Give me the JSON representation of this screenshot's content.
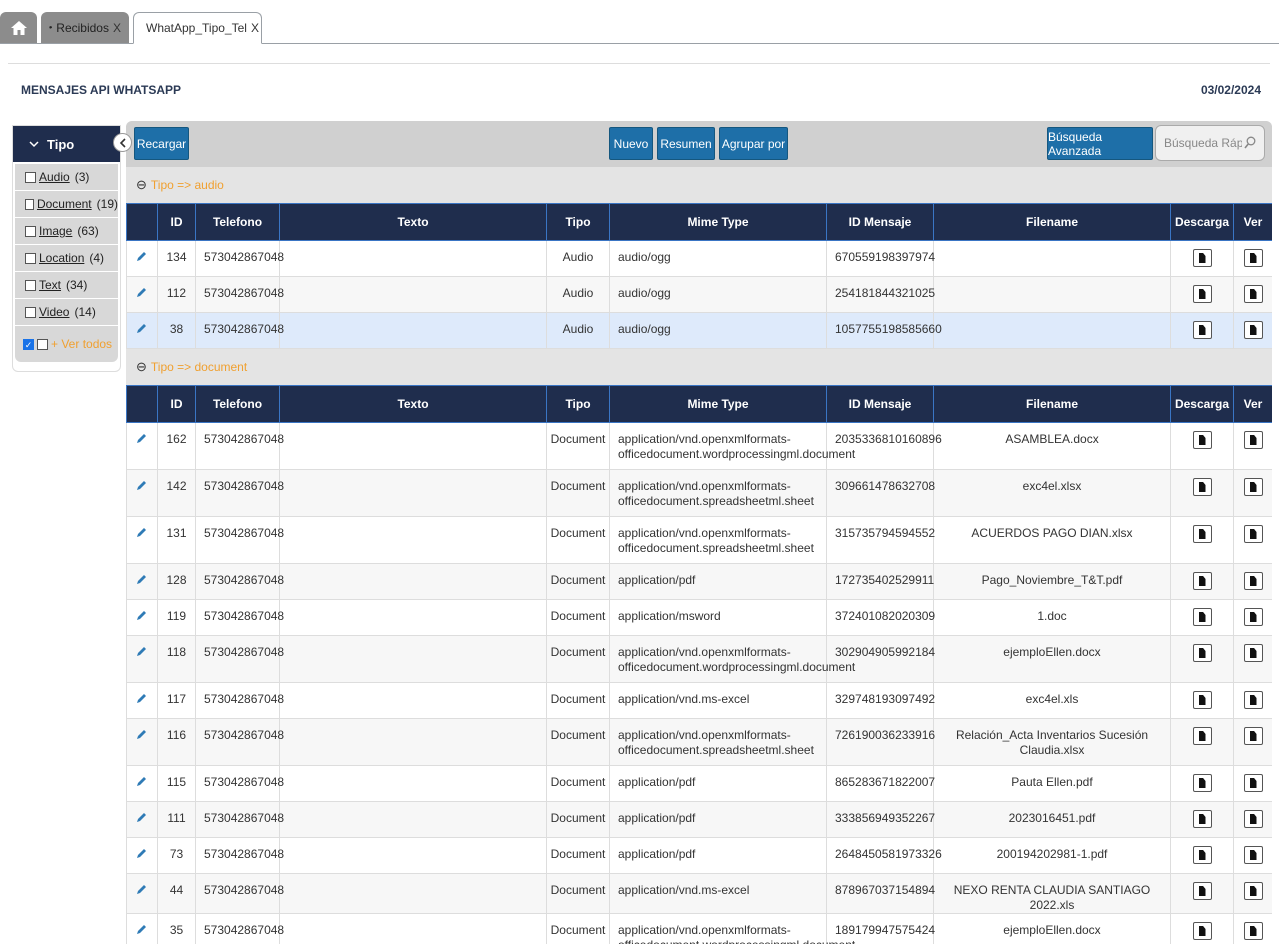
{
  "tabs": [
    {
      "label": "Recibidos",
      "close": "X"
    },
    {
      "label": "WhatApp_Tipo_Tel",
      "close": "X"
    }
  ],
  "page": {
    "title": "MENSAJES API WHATSAPP",
    "date": "03/02/2024"
  },
  "filter": {
    "title": "Tipo",
    "items": [
      {
        "label": "Audio",
        "count": "(3)"
      },
      {
        "label": "Document",
        "count": "(19)"
      },
      {
        "label": "Image",
        "count": "(63)"
      },
      {
        "label": "Location",
        "count": "(4)"
      },
      {
        "label": "Text",
        "count": "(34)"
      },
      {
        "label": "Video",
        "count": "(14)"
      }
    ],
    "all_label": "+ Ver todos"
  },
  "toolbar": {
    "reload": "Recargar",
    "new": "Nuevo",
    "summary": "Resumen",
    "group_by": "Agrupar por",
    "advanced_search": "Búsqueda Avanzada",
    "quick_search_placeholder": "Búsqueda Rápida"
  },
  "columns": [
    "ID",
    "Telefono",
    "Texto",
    "Tipo",
    "Mime Type",
    "ID Mensaje",
    "Filename",
    "Descarga",
    "Ver"
  ],
  "groups": [
    {
      "label": "Tipo => audio",
      "rows": [
        {
          "id": "134",
          "tel": "573042867048",
          "texto": "",
          "tipo": "Audio",
          "mime": "audio/ogg",
          "msg": "670559198397974",
          "file": ""
        },
        {
          "id": "112",
          "tel": "573042867048",
          "texto": "",
          "tipo": "Audio",
          "mime": "audio/ogg",
          "msg": "254181844321025",
          "file": ""
        },
        {
          "id": "38",
          "tel": "573042867048",
          "texto": "",
          "tipo": "Audio",
          "mime": "audio/ogg",
          "msg": "1057755198585660",
          "file": ""
        }
      ]
    },
    {
      "label": "Tipo => document",
      "rows": [
        {
          "id": "162",
          "tel": "573042867048",
          "texto": "",
          "tipo": "Document",
          "mime": "application/vnd.openxmlformats-officedocument.wordprocessingml.document",
          "msg": "2035336810160896",
          "file": "ASAMBLEA.docx"
        },
        {
          "id": "142",
          "tel": "573042867048",
          "texto": "",
          "tipo": "Document",
          "mime": "application/vnd.openxmlformats-officedocument.spreadsheetml.sheet",
          "msg": "309661478632708",
          "file": "exc4el.xlsx"
        },
        {
          "id": "131",
          "tel": "573042867048",
          "texto": "",
          "tipo": "Document",
          "mime": "application/vnd.openxmlformats-officedocument.spreadsheetml.sheet",
          "msg": "315735794594552",
          "file": "ACUERDOS PAGO DIAN.xlsx"
        },
        {
          "id": "128",
          "tel": "573042867048",
          "texto": "",
          "tipo": "Document",
          "mime": "application/pdf",
          "msg": "172735402529911",
          "file": "Pago_Noviembre_T&T.pdf"
        },
        {
          "id": "119",
          "tel": "573042867048",
          "texto": "",
          "tipo": "Document",
          "mime": "application/msword",
          "msg": "372401082020309",
          "file": "1.doc"
        },
        {
          "id": "118",
          "tel": "573042867048",
          "texto": "",
          "tipo": "Document",
          "mime": "application/vnd.openxmlformats-officedocument.wordprocessingml.document",
          "msg": "302904905992184",
          "file": "ejemploEllen.docx"
        },
        {
          "id": "117",
          "tel": "573042867048",
          "texto": "",
          "tipo": "Document",
          "mime": "application/vnd.ms-excel",
          "msg": "329748193097492",
          "file": "exc4el.xls"
        },
        {
          "id": "116",
          "tel": "573042867048",
          "texto": "",
          "tipo": "Document",
          "mime": "application/vnd.openxmlformats-officedocument.spreadsheetml.sheet",
          "msg": "726190036233916",
          "file": "Relación_Acta Inventarios Sucesión Claudia.xlsx"
        },
        {
          "id": "115",
          "tel": "573042867048",
          "texto": "",
          "tipo": "Document",
          "mime": "application/pdf",
          "msg": "865283671822007",
          "file": "Pauta Ellen.pdf"
        },
        {
          "id": "111",
          "tel": "573042867048",
          "texto": "",
          "tipo": "Document",
          "mime": "application/pdf",
          "msg": "333856949352267",
          "file": "2023016451.pdf"
        },
        {
          "id": "73",
          "tel": "573042867048",
          "texto": "",
          "tipo": "Document",
          "mime": "application/pdf",
          "msg": "2648450581973326",
          "file": "200194202981-1.pdf"
        },
        {
          "id": "44",
          "tel": "573042867048",
          "texto": "",
          "tipo": "Document",
          "mime": "application/vnd.ms-excel",
          "msg": "878967037154894",
          "file": "NEXO RENTA CLAUDIA SANTIAGO 2022.xls"
        },
        {
          "id": "35",
          "tel": "573042867048",
          "texto": "",
          "tipo": "Document",
          "mime": "application/vnd.openxmlformats-officedocument.wordprocessingml.document",
          "msg": "189179947575424",
          "file": "ejemploEllen.docx"
        }
      ]
    }
  ]
}
